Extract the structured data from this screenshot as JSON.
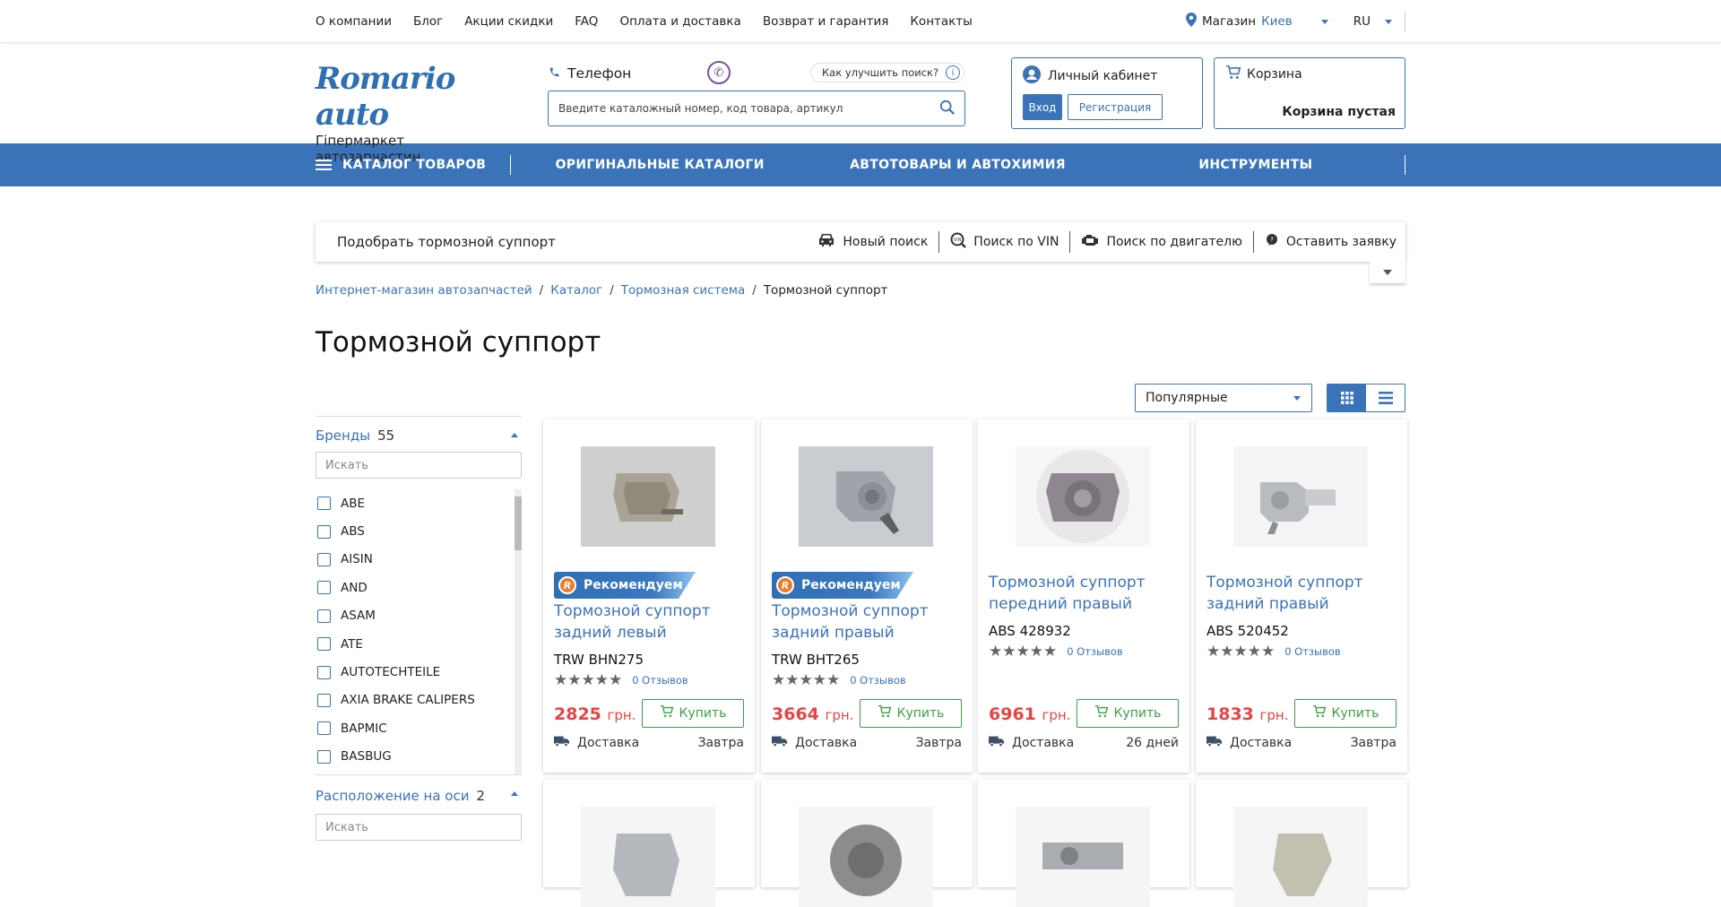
{
  "topbar": {
    "links": [
      "О компании",
      "Блог",
      "Акции скидки",
      "FAQ",
      "Оплата и доставка",
      "Возврат и гарантия",
      "Контакты"
    ],
    "store_label": "Магазин",
    "store_city": "Киев",
    "lang": "RU"
  },
  "header": {
    "logo_text": "Romario auto",
    "logo_sub": "Гіпермаркет автозапчастин",
    "phone_label": "Телефон",
    "improve_search": "Как улучшить поиск?",
    "search_placeholder": "Введите каталожный номер, код товара, артикул",
    "account_title": "Личный кабинет",
    "login": "Вход",
    "register": "Регистрация",
    "cart_title": "Корзина",
    "cart_empty": "Корзина пустая"
  },
  "nav": {
    "catalog": "КАТАЛОГ ТОВАРОВ",
    "items": [
      "ОРИГИНАЛЬНЫЕ КАТАЛОГИ",
      "АВТОТОВАРЫ И АВТОХИМИЯ",
      "ИНСТРУМЕНТЫ"
    ]
  },
  "picker": {
    "title": "Подобрать тормозной суппорт",
    "tools": [
      "Новый поиск",
      "Поиск по VIN",
      "Поиск по двигателю",
      "Оставить заявку"
    ]
  },
  "breadcrumbs": [
    "Интернет-магазин автозапчастей",
    "Каталог",
    "Тормозная система",
    "Тормозной суппорт"
  ],
  "page_title": "Тормозной суппорт",
  "sort": {
    "selected": "Популярные"
  },
  "filters": {
    "brands_label": "Бренды",
    "brands_count": "55",
    "search_placeholder": "Искать",
    "brands": [
      "ABE",
      "ABS",
      "AISIN",
      "AND",
      "ASAM",
      "ATE",
      "AUTOTECHTEILE",
      "AXIA BRAKE CALIPERS",
      "BAPMIC",
      "BASBUG"
    ],
    "axis_label": "Расположение на оси",
    "axis_count": "2"
  },
  "products": [
    {
      "badge": "Рекомендуем",
      "name": "Тормозной суппорт задний левый",
      "sku": "TRW BHN275",
      "reviews": "0 Отзывов",
      "price": "2825",
      "currency": "грн.",
      "buy": "Купить",
      "delivery_label": "Доставка",
      "delivery": "Завтра"
    },
    {
      "badge": "Рекомендуем",
      "name": "Тормозной суппорт задний правый",
      "sku": "TRW BHT265",
      "reviews": "0 Отзывов",
      "price": "3664",
      "currency": "грн.",
      "buy": "Купить",
      "delivery_label": "Доставка",
      "delivery": "Завтра"
    },
    {
      "badge": "",
      "name": "Тормозной суппорт передний правый",
      "sku": "ABS 428932",
      "reviews": "0 Отзывов",
      "price": "6961",
      "currency": "грн.",
      "buy": "Купить",
      "delivery_label": "Доставка",
      "delivery": "26 дней"
    },
    {
      "badge": "",
      "name": "Тормозной суппорт задний правый",
      "sku": "ABS 520452",
      "reviews": "0 Отзывов",
      "price": "1833",
      "currency": "грн.",
      "buy": "Купить",
      "delivery_label": "Доставка",
      "delivery": "Завтра"
    }
  ],
  "colors": {
    "brand": "#3a73b8",
    "price": "#e84343",
    "buy": "#39a045",
    "badge_icon": "#f07a2a"
  }
}
